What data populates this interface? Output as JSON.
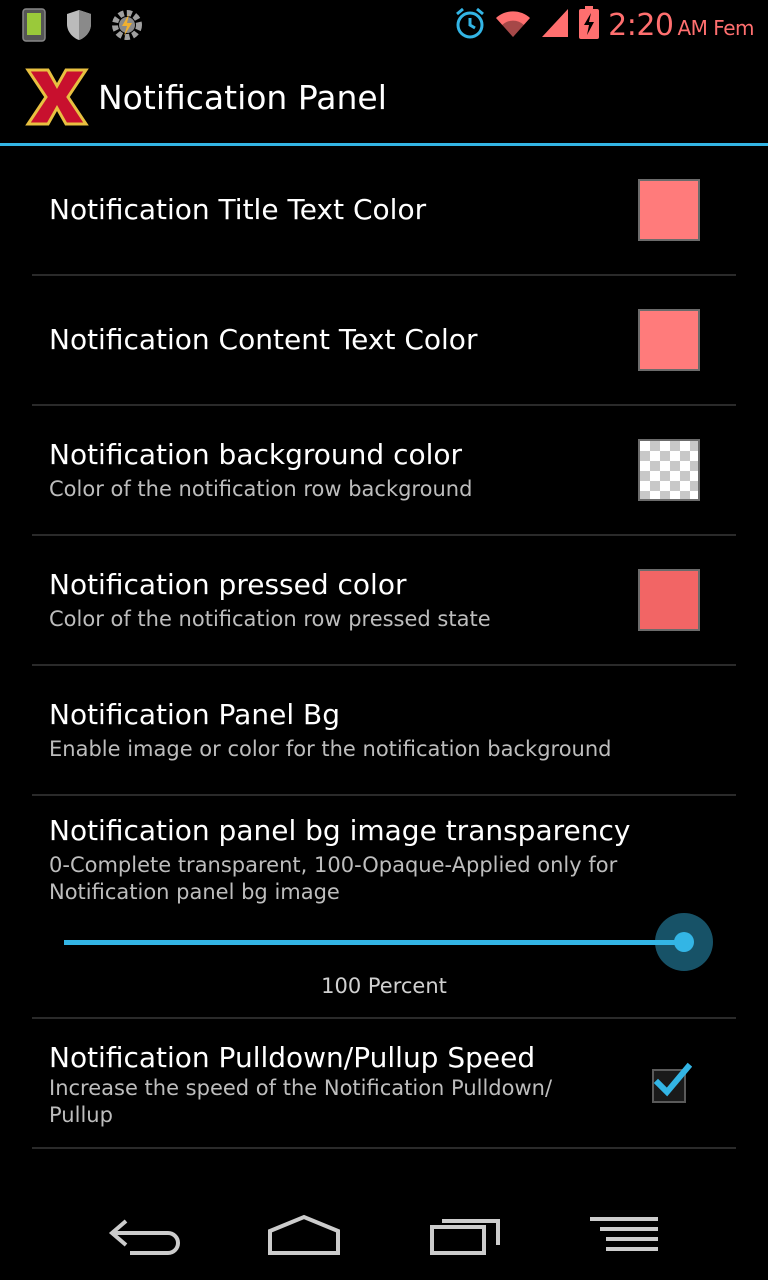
{
  "status_bar": {
    "time": "2:20",
    "time_suffix": "AM Fem",
    "clock_color": "#ff6f6f",
    "icons": [
      "phone-battery-icon",
      "shield-icon",
      "tasker-gear-icon",
      "alarm-icon",
      "wifi-icon",
      "signal-icon",
      "battery-charging-icon"
    ]
  },
  "action_bar": {
    "title": "Notification Panel",
    "logo_icon": "x-logo-icon",
    "accent_color": "#33b5e5"
  },
  "preferences": [
    {
      "title": "Notification Title Text Color",
      "summary": "",
      "widget": "color-swatch",
      "color": "#ff7b7b"
    },
    {
      "title": "Notification Content Text Color",
      "summary": "",
      "widget": "color-swatch",
      "color": "#ff7b7b"
    },
    {
      "title": "Notification background color",
      "summary": "Color of the notification row background",
      "widget": "color-swatch",
      "color": "transparent"
    },
    {
      "title": "Notification pressed color",
      "summary": "Color of the notification row pressed state",
      "widget": "color-swatch",
      "color": "#f26565"
    },
    {
      "title": "Notification Panel Bg",
      "summary": "Enable image or color for the notification background",
      "widget": "none"
    },
    {
      "title": "Notification panel bg image transparency",
      "summary": "0-Complete transparent, 100-Opaque-Applied only for Notification panel bg image",
      "widget": "slider",
      "value_fraction": 1.0,
      "value_label": "100 Percent"
    },
    {
      "title": "Notification Pulldown/Pullup Speed",
      "summary": "Increase the speed of the Notification Pulldown/ Pullup",
      "widget": "checkbox",
      "checked": true
    }
  ],
  "nav_bar": {
    "icons": [
      "back-icon",
      "home-icon",
      "recent-apps-icon",
      "menu-icon"
    ]
  }
}
